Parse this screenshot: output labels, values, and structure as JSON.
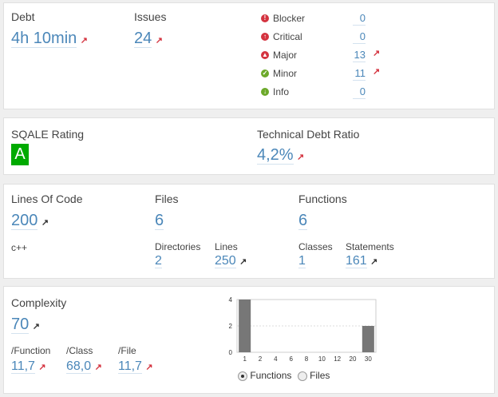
{
  "debt": {
    "label": "Debt",
    "value": "4h 10min",
    "trend": "up"
  },
  "issues": {
    "label": "Issues",
    "value": "24",
    "trend": "up",
    "severities": [
      {
        "label": "Blocker",
        "count": "0",
        "icon": "blocker-icon",
        "color": "#d4333f",
        "trend": ""
      },
      {
        "label": "Critical",
        "count": "0",
        "icon": "critical-icon",
        "color": "#d4333f",
        "trend": ""
      },
      {
        "label": "Major",
        "count": "13",
        "icon": "major-icon",
        "color": "#d4333f",
        "trend": "up"
      },
      {
        "label": "Minor",
        "count": "11",
        "icon": "minor-icon",
        "color": "#6ca92a",
        "trend": "up"
      },
      {
        "label": "Info",
        "count": "0",
        "icon": "info-icon",
        "color": "#6ca92a",
        "trend": ""
      }
    ]
  },
  "sqale": {
    "label": "SQALE Rating",
    "rating": "A",
    "rating_color": "#00aa00"
  },
  "tdr": {
    "label": "Technical Debt Ratio",
    "value": "4,2%",
    "trend": "up"
  },
  "size": {
    "loc_label": "Lines Of Code",
    "loc_value": "200",
    "language": "c++",
    "files_label": "Files",
    "files_value": "6",
    "directories_label": "Directories",
    "directories_value": "2",
    "lines_label": "Lines",
    "lines_value": "250",
    "functions_label": "Functions",
    "functions_value": "6",
    "classes_label": "Classes",
    "classes_value": "1",
    "statements_label": "Statements",
    "statements_value": "161"
  },
  "complexity": {
    "label": "Complexity",
    "value": "70",
    "per_function_label": "/Function",
    "per_function_value": "11,7",
    "per_class_label": "/Class",
    "per_class_value": "68,0",
    "per_file_label": "/File",
    "per_file_value": "11,7"
  },
  "distribution": {
    "options": [
      "Functions",
      "Files"
    ],
    "selected": "Functions"
  },
  "chart_data": {
    "type": "bar",
    "categories": [
      "1",
      "2",
      "4",
      "6",
      "8",
      "10",
      "12",
      "20",
      "30"
    ],
    "values": [
      4,
      0,
      0,
      0,
      0,
      0,
      0,
      0,
      2
    ],
    "ylim": [
      0,
      4
    ],
    "yticks": [
      "0",
      "2",
      "4"
    ],
    "grid": true,
    "bar_color": "#777777"
  },
  "colors": {
    "link": "#4b87b9",
    "trend_up": "#d4333f"
  }
}
